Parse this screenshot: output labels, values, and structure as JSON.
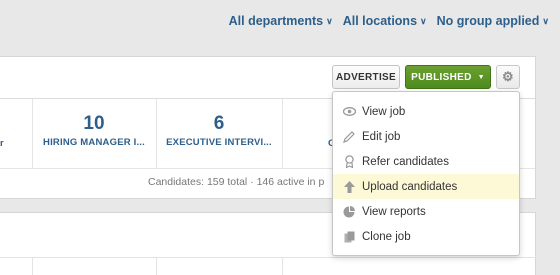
{
  "filters": {
    "departments": "All departments",
    "locations": "All locations",
    "group": "No group applied"
  },
  "toolbar": {
    "advertise_label": "ADVERTISE",
    "published_label": "PUBLISHED",
    "settings_icon": "gear-icon"
  },
  "stats": [
    {
      "value": "10",
      "label": "HIRING MANAGER I..."
    },
    {
      "value": "6",
      "label": "EXECUTIVE INTERVI..."
    }
  ],
  "stats_partial_left": "r",
  "stats_partial_right": "C",
  "candidates_summary": "Candidates: 159 total · 146 active in p",
  "menu": {
    "items": [
      {
        "label": "View job",
        "icon": "eye-icon"
      },
      {
        "label": "Edit job",
        "icon": "pencil-icon"
      },
      {
        "label": "Refer candidates",
        "icon": "award-icon"
      },
      {
        "label": "Upload candidates",
        "icon": "upload-arrow-icon"
      },
      {
        "label": "View reports",
        "icon": "pie-chart-icon"
      },
      {
        "label": "Clone job",
        "icon": "copy-icon"
      }
    ],
    "active_item": "Upload candidates"
  },
  "colors": {
    "accent_green": "#5a9527",
    "link_blue": "#2d5f8a",
    "highlight": "#fdf8d6"
  }
}
